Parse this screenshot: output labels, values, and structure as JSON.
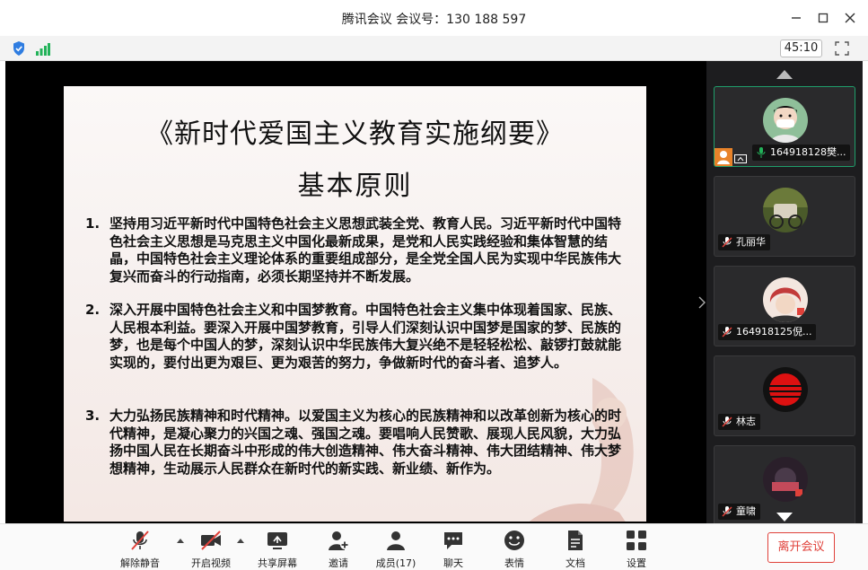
{
  "window": {
    "title": "腾讯会议 会议号：130 188 597"
  },
  "status": {
    "timer": "45:10"
  },
  "slide": {
    "title": "《新时代爱国主义教育实施纲要》",
    "subtitle": "基本原则",
    "items": [
      {
        "num": "1.",
        "text": "坚持用习近平新时代中国特色社会主义思想武装全党、教育人民。习近平新时代中国特色社会主义思想是马克思主义中国化最新成果，是党和人民实践经验和集体智慧的结晶，中国特色社会主义理论体系的重要组成部分，是全党全国人民为实现中华民族伟大复兴而奋斗的行动指南，必须长期坚持并不断发展。"
      },
      {
        "num": "2.",
        "text": "深入开展中国特色社会主义和中国梦教育。中国特色社会主义集中体现着国家、民族、人民根本利益。要深入开展中国梦教育，引导人们深刻认识中国梦是国家的梦、民族的梦，也是每个中国人的梦，深刻认识中华民族伟大复兴绝不是轻轻松松、敲锣打鼓就能实现的，要付出更为艰巨、更为艰苦的努力，争做新时代的奋斗者、追梦人。"
      },
      {
        "num": "3.",
        "text": "大力弘扬民族精神和时代精神。以爱国主义为核心的民族精神和以改革创新为核心的时代精神，是凝心聚力的兴国之魂、强国之魂。要唱响人民赞歌、展现人民风貌，大力弘扬中国人民在长期奋斗中形成的伟大创造精神、伟大奋斗精神、伟大团结精神、伟大梦想精神，生动展示人民群众在新时代的新实践、新业绩、新作为。"
      }
    ]
  },
  "participants": [
    {
      "name": "164918128樊...",
      "avatar": "avatar-boy-mask",
      "color": "#8fbf9a"
    },
    {
      "name": "孔丽华",
      "avatar": "avatar-carriage",
      "color": "#6b7a3a"
    },
    {
      "name": "164918125倪...",
      "avatar": "avatar-redhair",
      "color": "#c23a3a"
    },
    {
      "name": "林志",
      "avatar": "avatar-acmilan",
      "color": "#d11"
    },
    {
      "name": "童啸",
      "avatar": "avatar-dark",
      "color": "#3a2a3a"
    }
  ],
  "toolbar": {
    "mute": "解除静音",
    "video": "开启视频",
    "share": "共享屏幕",
    "invite": "邀请",
    "members": "成员(17)",
    "chat": "聊天",
    "reactions": "表情",
    "docs": "文档",
    "settings": "设置",
    "leave": "离开会议"
  },
  "colors": {
    "accent": "#1f9e6b",
    "danger": "#e0413a",
    "host": "#e8832a"
  }
}
